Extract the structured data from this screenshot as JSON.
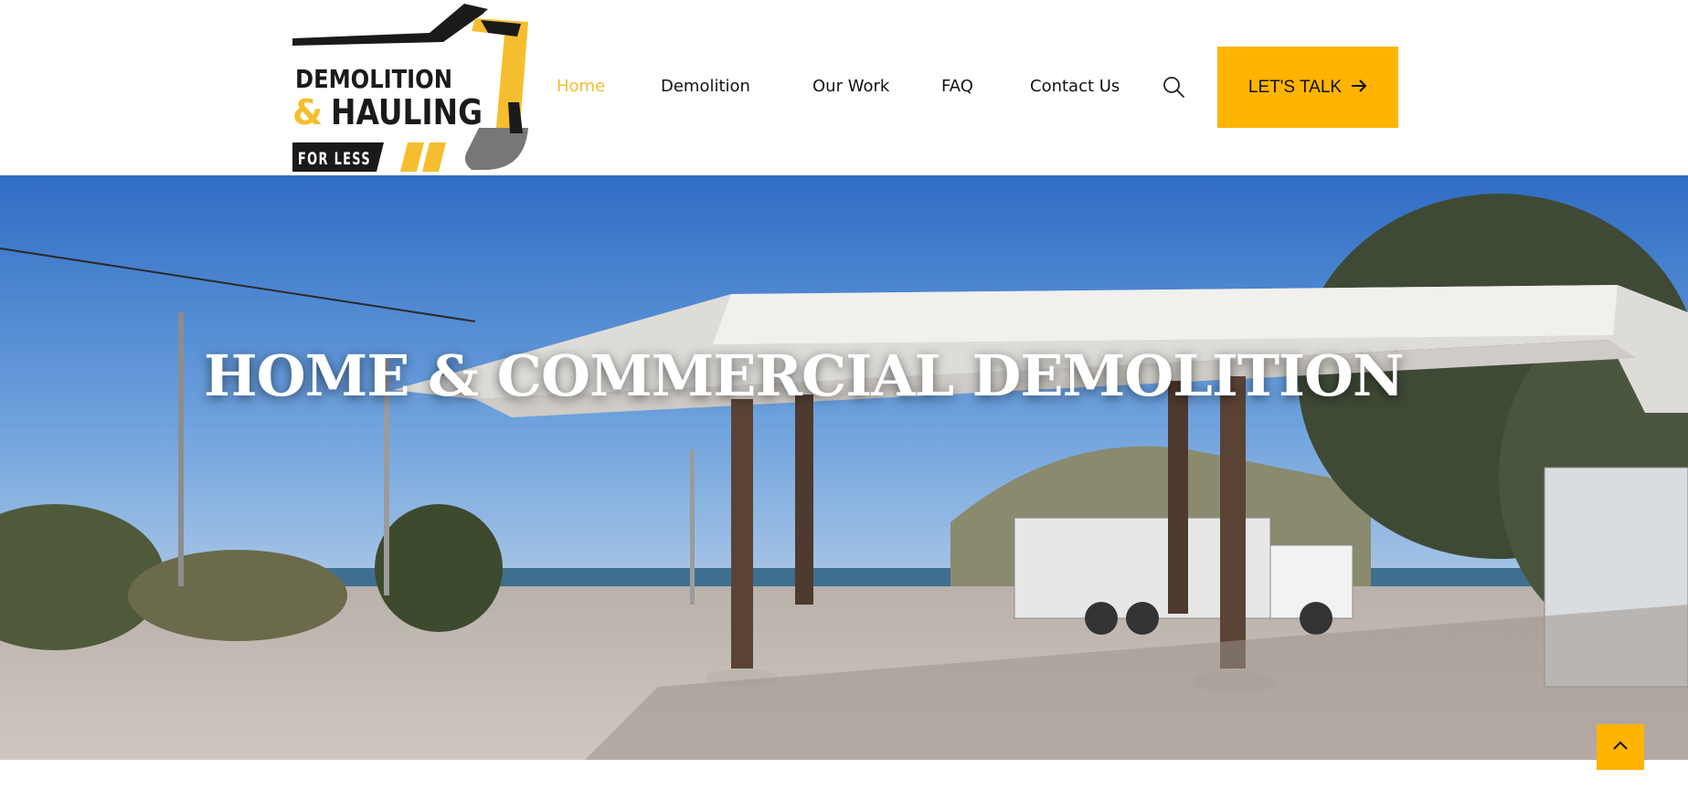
{
  "logo": {
    "line1": "DEMOLITION",
    "line2_amp": "&",
    "line2_word": "HAULING",
    "line3": "FOR LESS",
    "icon": "excavator-arm-icon"
  },
  "nav": {
    "items": [
      {
        "label": "Home",
        "active": true
      },
      {
        "label": "Demolition",
        "active": false
      },
      {
        "label": "Our Work",
        "active": false
      },
      {
        "label": "FAQ",
        "active": false
      },
      {
        "label": "Contact Us",
        "active": false
      }
    ],
    "search_icon": "search-icon"
  },
  "cta": {
    "label": "LET'S TALK",
    "icon": "arrow-right-icon"
  },
  "hero": {
    "title": "HOME & COMMERCIAL DEMOLITION",
    "image": "abandoned-gas-station-canopy-photo"
  },
  "scroll_top": {
    "icon": "chevron-up-icon"
  },
  "colors": {
    "accent": "#ffb400",
    "nav_active": "#f5be2e",
    "text": "#111111",
    "logo_dark": "#1a1a1a",
    "logo_yellow": "#f5be2e"
  }
}
